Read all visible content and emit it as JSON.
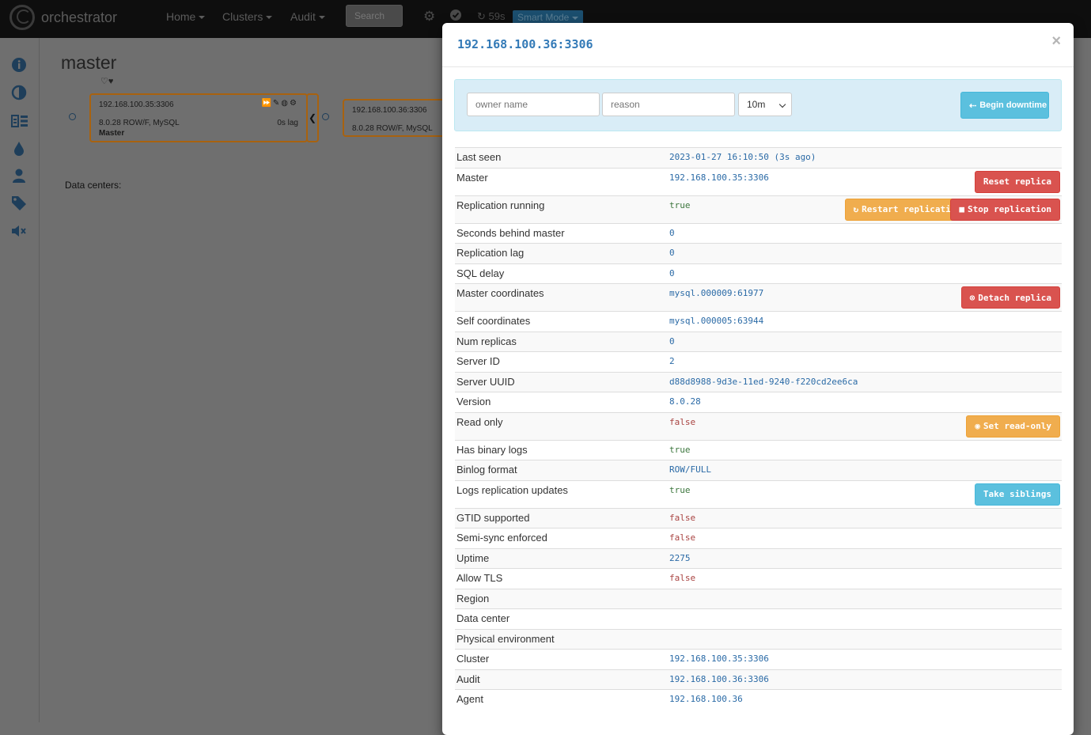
{
  "navbar": {
    "brand": "orchestrator",
    "menus": [
      {
        "label": "Home"
      },
      {
        "label": "Clusters"
      },
      {
        "label": "Audit"
      }
    ],
    "search_label": "Search",
    "refresh_timer": "59s",
    "smart_mode": "Smart Mode"
  },
  "sidebar": {
    "icons": [
      "info-icon",
      "contrast-icon",
      "tiles-icon",
      "drop-icon",
      "user-icon",
      "tag-icon",
      "mute-icon"
    ]
  },
  "background": {
    "cluster_title": "master",
    "nodes": [
      {
        "ip": "192.168.100.35:3306",
        "version": "8.0.28 ROW/F, MySQL",
        "lag": "0s lag",
        "role": "Master"
      },
      {
        "ip": "192.168.100.36:3306",
        "version": "8.0.28 ROW/F, MySQL"
      }
    ],
    "data_centers_label": "Data centers:"
  },
  "modal": {
    "title": "192.168.100.36:3306",
    "close_symbol": "×",
    "downtime": {
      "owner_placeholder": "owner name",
      "reason_placeholder": "reason",
      "duration_selected": "10m",
      "begin_button": "Begin downtime"
    },
    "rows": [
      {
        "key": "Last seen",
        "value": "2023-01-27 16:10:50 (3s ago)"
      },
      {
        "key": "Master",
        "value": "192.168.100.35:3306",
        "button": "Reset replica"
      },
      {
        "key": "Replication running",
        "value": "true",
        "button_restart": "Restart replication",
        "button_stop": "Stop replication"
      },
      {
        "key": "Seconds behind master",
        "value": "0"
      },
      {
        "key": "Replication lag",
        "value": "0"
      },
      {
        "key": "SQL delay",
        "value": "0"
      },
      {
        "key": "Master coordinates",
        "value": "mysql.000009:61977",
        "button": "Detach replica"
      },
      {
        "key": "Self coordinates",
        "value": "mysql.000005:63944"
      },
      {
        "key": "Num replicas",
        "value": "0"
      },
      {
        "key": "Server ID",
        "value": "2"
      },
      {
        "key": "Server UUID",
        "value": "d88d8988-9d3e-11ed-9240-f220cd2ee6ca"
      },
      {
        "key": "Version",
        "value": "8.0.28"
      },
      {
        "key": "Read only",
        "value": "false",
        "button": "Set read-only"
      },
      {
        "key": "Has binary logs",
        "value": "true"
      },
      {
        "key": "Binlog format",
        "value": "ROW/FULL"
      },
      {
        "key": "Logs replication updates",
        "value": "true",
        "button": "Take siblings"
      },
      {
        "key": "GTID supported",
        "value": "false"
      },
      {
        "key": "Semi-sync enforced",
        "value": "false"
      },
      {
        "key": "Uptime",
        "value": "2275"
      },
      {
        "key": "Allow TLS",
        "value": "false"
      },
      {
        "key": "Region",
        "value": ""
      },
      {
        "key": "Data center",
        "value": ""
      },
      {
        "key": "Physical environment",
        "value": ""
      },
      {
        "key": "Cluster",
        "value": "192.168.100.35:3306"
      },
      {
        "key": "Audit",
        "value": "192.168.100.36:3306"
      },
      {
        "key": "Agent",
        "value": "192.168.100.36"
      }
    ]
  },
  "colors": {
    "navbar_bg": "#0e0e0e",
    "overlay_bg": "#6f6f6f",
    "link_blue": "#337ab7",
    "true_green": "#3c763d",
    "false_red": "#a94442",
    "btn_info": "#5bc0de",
    "btn_danger": "#d9534f",
    "btn_warning": "#f0ad4e",
    "node_border": "#a8620f"
  }
}
